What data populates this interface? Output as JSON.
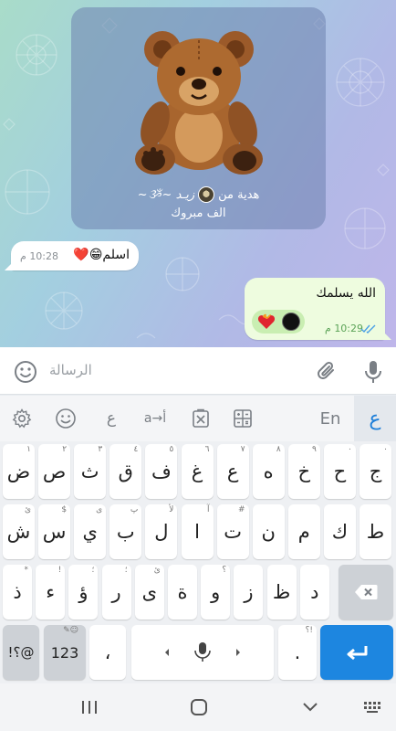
{
  "chat": {
    "gift_card": {
      "gift_label": "هدية من",
      "sender_name": "زيـد ~ૐ~",
      "congrats": "الف مبروك"
    },
    "incoming_message": {
      "text": "اسلم😁❤️",
      "time": "10:28 م"
    },
    "outgoing_message": {
      "text": "الله يسلمك",
      "time": "10:29 م",
      "status": "read",
      "reaction": "❤️‍🔥"
    }
  },
  "input_bar": {
    "placeholder": "الرسالة"
  },
  "keyboard_toolbar": {
    "items": [
      "settings",
      "emoji",
      "arabic-script",
      "translate",
      "clipboard",
      "number-pad",
      "En",
      "ع"
    ],
    "en_label": "En",
    "arabic_label": "ع",
    "script_label": "ع",
    "translate_label": "a→أ"
  },
  "keyboard": {
    "row1": [
      {
        "key": "ض",
        "hint": "١"
      },
      {
        "key": "ص",
        "hint": "٢"
      },
      {
        "key": "ث",
        "hint": "٣"
      },
      {
        "key": "ق",
        "hint": "٤"
      },
      {
        "key": "ف",
        "hint": "٥"
      },
      {
        "key": "غ",
        "hint": "٦"
      },
      {
        "key": "ع",
        "hint": "٧"
      },
      {
        "key": "ه",
        "hint": "٨"
      },
      {
        "key": "خ",
        "hint": "٩"
      },
      {
        "key": "ح",
        "hint": "٠"
      },
      {
        "key": "ج",
        "hint": "٠"
      }
    ],
    "row2": [
      {
        "key": "ش",
        "hint": "ئ"
      },
      {
        "key": "س",
        "hint": "$"
      },
      {
        "key": "ي",
        "hint": "ى"
      },
      {
        "key": "ب",
        "hint": "پ"
      },
      {
        "key": "ل",
        "hint": "لأ"
      },
      {
        "key": "ا",
        "hint": "آ"
      },
      {
        "key": "ت",
        "hint": "#"
      },
      {
        "key": "ن",
        "hint": ""
      },
      {
        "key": "م",
        "hint": ""
      },
      {
        "key": "ك",
        "hint": ""
      },
      {
        "key": "ط",
        "hint": ""
      }
    ],
    "row3": [
      {
        "key": "ذ",
        "hint": "*"
      },
      {
        "key": "ء",
        "hint": "!"
      },
      {
        "key": "ؤ",
        "hint": "؛"
      },
      {
        "key": "ر",
        "hint": "؛"
      },
      {
        "key": "ى",
        "hint": "ئ"
      },
      {
        "key": "ة",
        "hint": ""
      },
      {
        "key": "و",
        "hint": "؟"
      },
      {
        "key": "ز",
        "hint": ""
      },
      {
        "key": "ظ",
        "hint": ""
      },
      {
        "key": "د",
        "hint": ""
      }
    ],
    "symbols_label": "!؟@",
    "numbers_label": "123",
    "comma_label": "،",
    "period_label": ".",
    "comma_hint": "",
    "period_hint": "؟!"
  },
  "colors": {
    "accent": "#1d86e0",
    "outgoing_bubble": "#eefcdf",
    "read_ticks": "#4aa0e6"
  }
}
